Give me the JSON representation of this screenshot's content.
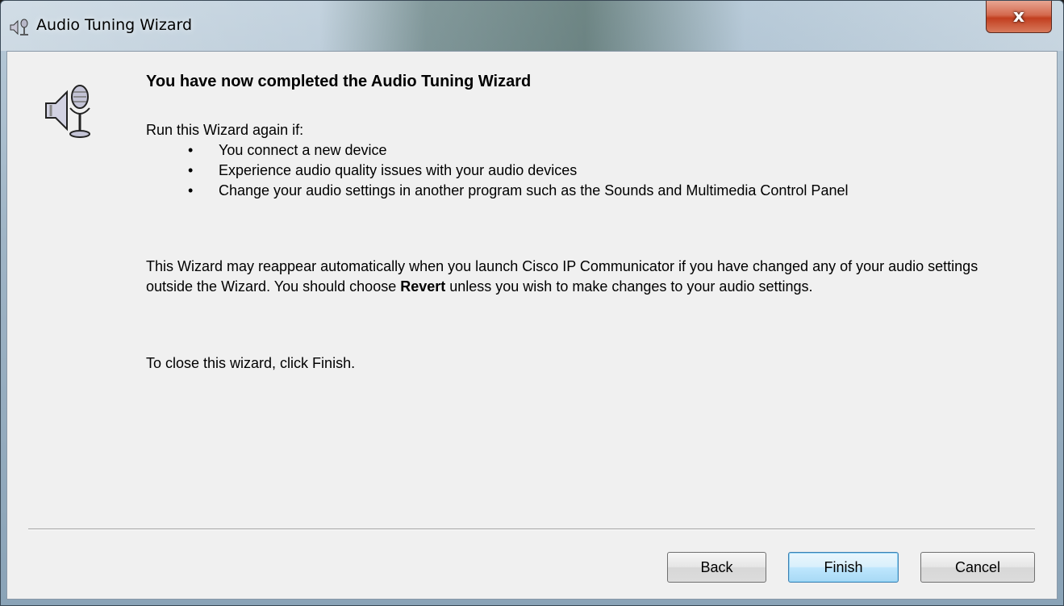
{
  "window": {
    "title": "Audio Tuning Wizard",
    "close_label": "x"
  },
  "content": {
    "heading": "You have now completed the Audio Tuning Wizard",
    "intro": "Run this Wizard again if:",
    "bullets": [
      "You connect a new device",
      "Experience audio quality issues with your audio devices",
      "Change your audio settings in another program such as the Sounds and Multimedia Control Panel"
    ],
    "bullet_glyph": "•",
    "para_before": "This Wizard may reappear automatically when you launch Cisco IP Communicator if you have changed any of your audio settings outside the Wizard. You should choose ",
    "para_bold": "Revert",
    "para_after": " unless you wish to make changes to your audio settings.",
    "closing": "To close this wizard, click Finish."
  },
  "buttons": {
    "back": "Back",
    "finish": "Finish",
    "cancel": "Cancel"
  },
  "icons": {
    "title_icon": "speaker-microphone-icon",
    "wizard_icon": "speaker-microphone-icon"
  }
}
